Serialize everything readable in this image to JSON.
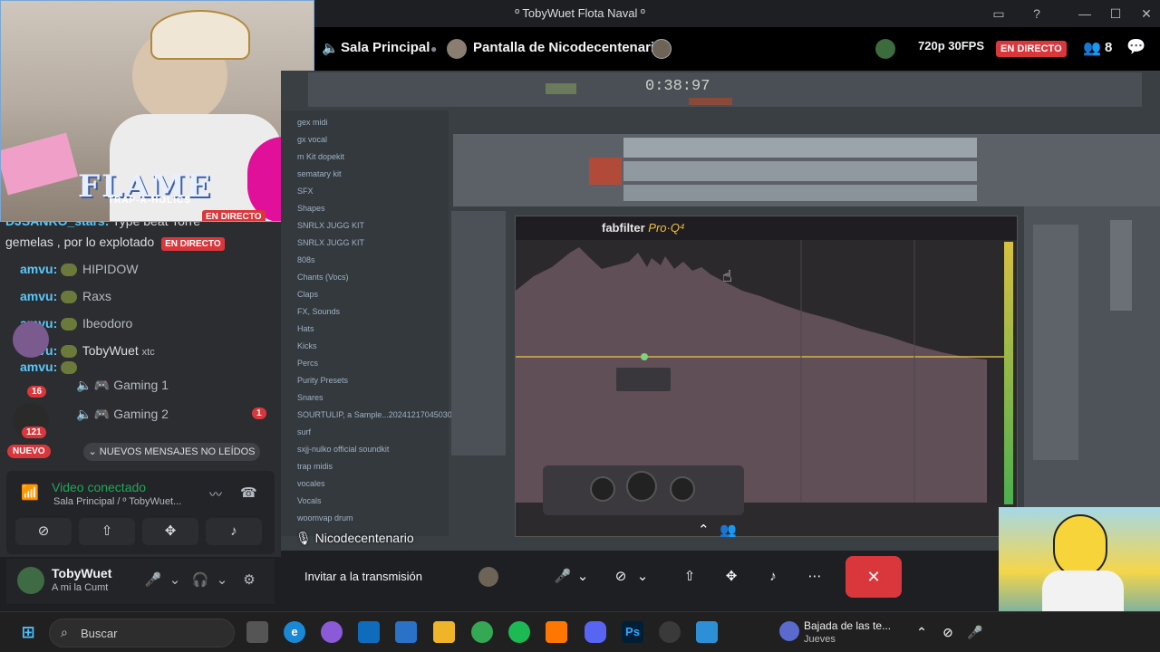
{
  "window": {
    "title": "º TobyWuet Flota Naval º"
  },
  "stream_header": {
    "channel": "Sala Principal",
    "screen_label": "Pantalla de Nicodecentenario",
    "quality": "720p 30FPS",
    "live_badge": "EN DIRECTO",
    "viewers": "8"
  },
  "webcam": {
    "overlay_title": "FLAME",
    "overlay_subtitle": "TRAP-A-HOLICS"
  },
  "chat": {
    "lines": [
      {
        "user": "DJSANRO_stars:",
        "text": "Type beat Torre"
      },
      {
        "user": "",
        "text": "gemelas , por lo explotado"
      },
      {
        "user": "amvu:",
        "text": "HIPIDOW"
      },
      {
        "user": "amvu:",
        "text": "Raxs"
      },
      {
        "user": "amvu:",
        "text": "Ibeodoro"
      },
      {
        "user": "amvu:",
        "text": "TobyWuet"
      },
      {
        "user": "amvu:",
        "text": ""
      }
    ],
    "live_badge": "EN DIRECTO",
    "live_badge_top": "EN DIRECTO",
    "tag": "xtc"
  },
  "channels": [
    {
      "name": "Gaming 1"
    },
    {
      "name": "Gaming 2",
      "ping": "1"
    }
  ],
  "guild_badges": {
    "first": "16",
    "second": "121"
  },
  "new_messages": "NUEVOS MENSAJES NO LEÍDOS",
  "nuevo_badge": "NUEVO",
  "voice": {
    "status": "Video conectado",
    "location": "Sala Principal / º TobyWuet..."
  },
  "user": {
    "name": "TobyWuet",
    "status": "A mi la Cumt"
  },
  "daw": {
    "time": "0:38:97",
    "plugin_brand": "fabfilter",
    "plugin_name": "Pro·Q⁴",
    "browser_items": [
      "gex midi",
      "gx vocal",
      "m Kit dopekit",
      "sematary kit",
      "SFX",
      "Shapes",
      "SNRLX JUGG KIT",
      "SNRLX JUGG KIT",
      "808s",
      "Chants (Vocs)",
      "Claps",
      "FX, Sounds",
      "Hats",
      "Kicks",
      "Percs",
      "Purity Presets",
      "Snares",
      "SOURTULIP, a Sample...20241217045030Z-001",
      "surf",
      "sxjj-nulko official soundkit",
      "trap midis",
      "vocales",
      "Vocals",
      "woomvap drum"
    ]
  },
  "sharer_name": "Nicodecentenario",
  "controls": {
    "invite": "Invitar a la transmisión"
  },
  "taskbar": {
    "search": "Buscar",
    "news_title": "Bajada de las te...",
    "news_sub": "Jueves"
  },
  "colors": {
    "live": "#da373c",
    "connected": "#23a55a",
    "accent": "#5865f2"
  }
}
